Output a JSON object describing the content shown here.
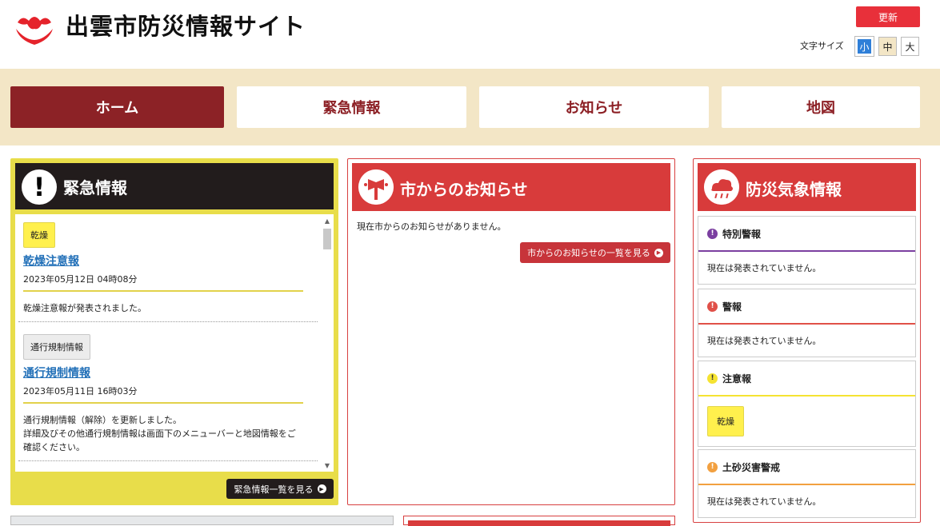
{
  "header": {
    "site_title": "出雲市防災情報サイト",
    "refresh_label": "更新",
    "font_size_label": "文字サイズ",
    "font_sizes": [
      "小",
      "中",
      "大"
    ]
  },
  "nav": {
    "tabs": [
      {
        "label": "ホーム",
        "active": true
      },
      {
        "label": "緊急情報",
        "active": false
      },
      {
        "label": "お知らせ",
        "active": false
      },
      {
        "label": "地図",
        "active": false
      }
    ]
  },
  "emergency": {
    "title": "緊急情報",
    "items": [
      {
        "tag": "乾燥",
        "title": "乾燥注意報",
        "date": "2023年05月12日 04時08分",
        "desc": "乾燥注意報が発表されました。"
      },
      {
        "tag": "通行規制情報",
        "title": "通行規制情報",
        "date": "2023年05月11日 16時03分",
        "desc": "通行規制情報（解除）を更新しました。\n詳細及びその他通行規制情報は画面下のメニューバーと地図情報をご確認ください。"
      }
    ],
    "more_label": "緊急情報一覧を見る"
  },
  "city_notice": {
    "title": "市からのお知らせ",
    "empty_text": "現在市からのお知らせがありません。",
    "more_label": "市からのお知らせの一覧を見る"
  },
  "weather": {
    "title": "防災気象情報",
    "sections": [
      {
        "label": "特別警報",
        "body": "現在は発表されていません。",
        "color": "#7b3fa0"
      },
      {
        "label": "警報",
        "body": "現在は発表されていません。",
        "color": "#e05048"
      },
      {
        "label": "注意報",
        "tag": "乾燥",
        "color": "#f5e332"
      },
      {
        "label": "土砂災害警戒",
        "body": "現在は発表されていません。",
        "color": "#f2a040"
      }
    ]
  },
  "colors": {
    "brand_red": "#d83b3b",
    "nav_active": "#8c2226",
    "nav_bg": "#f3e6c6",
    "emergency_bg": "#e8dd4a"
  }
}
